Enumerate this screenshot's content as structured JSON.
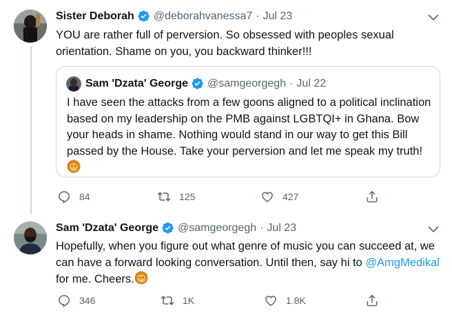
{
  "tweet1": {
    "name": "Sister Deborah",
    "handle": "@deborahvanessa7",
    "separator": "·",
    "date": "Jul 23",
    "text": "YOU are rather full of perversion. So obsessed with peoples sexual orientation. Shame on you, you backward thinker!!!",
    "replies": "84",
    "retweets": "125",
    "likes": "427"
  },
  "quote": {
    "name": "Sam 'Dzata' George",
    "handle": "@samgeorgegh",
    "separator": "·",
    "date": "Jul 22",
    "text": "I have seen the attacks from a few goons aligned to a political inclination based on my leadership on the PMB against LGBTQI+ in Ghana. Bow your heads in shame. Nothing would stand in our way to get this Bill passed by the House. Take your perversion and let me speak my truth!"
  },
  "tweet2": {
    "name": "Sam 'Dzata' George",
    "handle": "@samgeorgegh",
    "separator": "·",
    "date": "Jul 23",
    "text_before": "Hopefully, when you figure out what genre of music you can succeed at, we can have a forward looking conversation. Until then, say hi to ",
    "mention": "@AmgMedikal",
    "text_after": " for me. Cheers.",
    "replies": "346",
    "retweets": "1K",
    "likes": "1.8K"
  },
  "colors": {
    "verified": "#1d9bf0",
    "muted": "#536471",
    "link": "#1d9bf0",
    "border": "#cfd9de"
  },
  "icons": [
    "more-icon",
    "reply-icon",
    "retweet-icon",
    "like-icon",
    "share-icon",
    "verified-badge-icon",
    "lion-emoji"
  ]
}
